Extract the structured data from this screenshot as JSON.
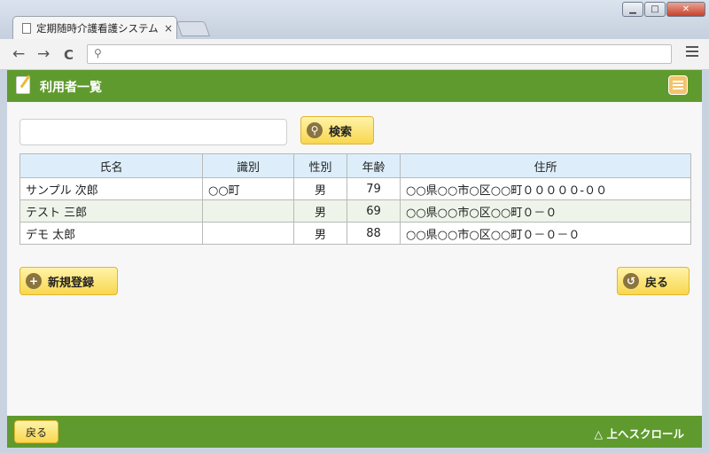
{
  "browser": {
    "tab_title": "定期随時介護看護システム",
    "tab_close": "×",
    "window_controls": {
      "minimize": "▁",
      "maximize": "□",
      "close": "✕"
    },
    "nav": {
      "back": "←",
      "forward": "→",
      "reload": "C"
    },
    "address_placeholder": ""
  },
  "header": {
    "title": "利用者一覧"
  },
  "search": {
    "placeholder": "",
    "button_label": "検索",
    "button_icon": "search-icon"
  },
  "table": {
    "columns": [
      "氏名",
      "識別",
      "性別",
      "年齢",
      "住所"
    ],
    "rows": [
      {
        "name": "サンプル 次郎",
        "id": "○○町",
        "sex": "男",
        "age": "79",
        "address": "○○県○○市○区○○町０００００-００"
      },
      {
        "name": "テスト 三郎",
        "id": "",
        "sex": "男",
        "age": "69",
        "address": "○○県○○市○区○○町０－０"
      },
      {
        "name": "デモ 太郎",
        "id": "",
        "sex": "男",
        "age": "88",
        "address": "○○県○○市○区○○町０－０－０"
      }
    ]
  },
  "actions": {
    "new_label": "新規登録",
    "back_label": "戻る"
  },
  "footer": {
    "back_label": "戻る",
    "scroll_top": "△ 上へスクロール"
  },
  "colors": {
    "header": "#5f9a2e",
    "button": "#f8d74e",
    "table_head": "#ddeefa"
  }
}
